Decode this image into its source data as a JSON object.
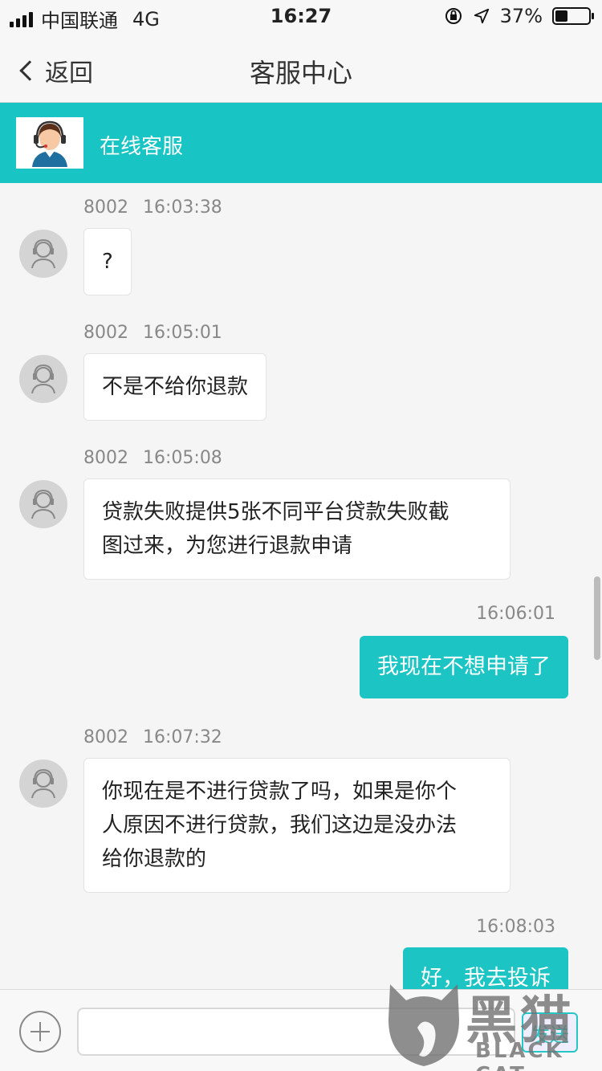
{
  "status_bar": {
    "carrier": "中国联通",
    "network": "4G",
    "time": "16:27",
    "battery": "37%",
    "battery_level": 0.37
  },
  "nav": {
    "back_label": "返回",
    "title": "客服中心"
  },
  "service": {
    "title": "在线客服"
  },
  "messages": [
    {
      "sender_id": "8002",
      "time": "16:03:38",
      "text": "?"
    },
    {
      "sender_id": "8002",
      "time": "16:05:01",
      "text": "不是不给你退款"
    },
    {
      "sender_id": "8002",
      "time": "16:05:08",
      "line1": "贷款失败提供5张不同平台贷款失败截",
      "line2": "图过来，为您进行退款申请"
    },
    {
      "time": "16:06:01",
      "text": "我现在不想申请了"
    },
    {
      "sender_id": "8002",
      "time": "16:07:32",
      "line1": "你现在是不进行贷款了吗，如果是你个",
      "line2": "人原因不进行贷款，我们这边是没办法",
      "line3": "给你退款的"
    },
    {
      "time": "16:08:03",
      "text": "好，我去投诉"
    }
  ],
  "input": {
    "placeholder": "",
    "send_label": "发送"
  },
  "watermark": {
    "cn": "黑猫",
    "en": "BLACK CAT"
  },
  "colors": {
    "accent": "#18c4c4",
    "out_bubble": "#1dc4c4",
    "background": "#f5f5f5"
  }
}
